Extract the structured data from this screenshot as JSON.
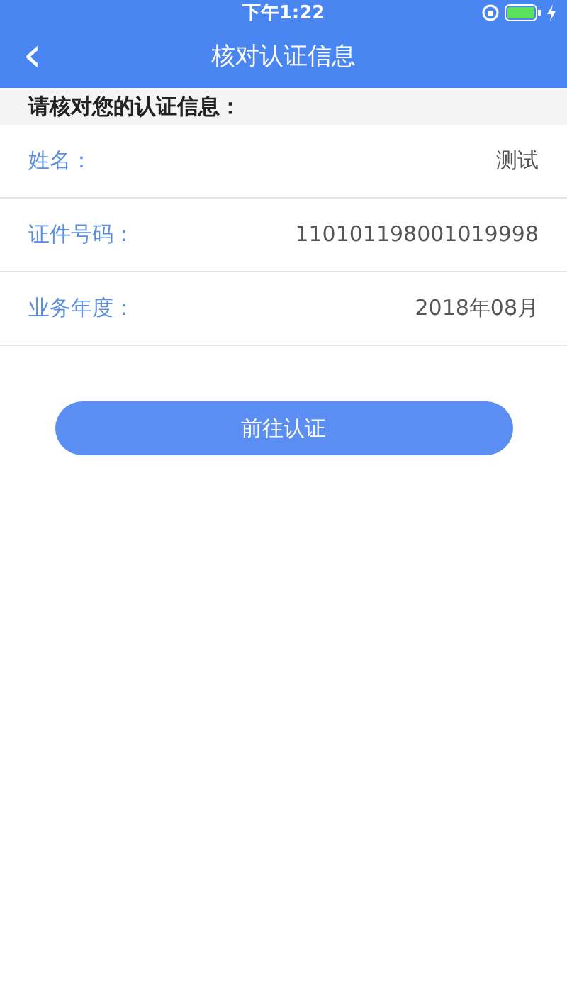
{
  "status_bar": {
    "time": "下午1:22"
  },
  "nav_bar": {
    "back": "‹",
    "title": "核对认证信息"
  },
  "section_header": "请核对您的认证信息：",
  "fields": [
    {
      "label": "姓名：",
      "value": "测试"
    },
    {
      "label": "证件号码：",
      "value": "110101198001019998"
    },
    {
      "label": "业务年度：",
      "value": "2018年08月"
    }
  ],
  "button": "前往认证"
}
